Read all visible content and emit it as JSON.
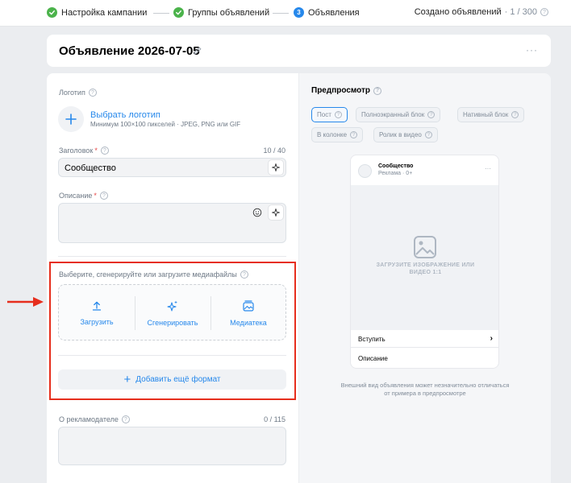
{
  "stepper": {
    "steps": [
      {
        "label": "Настройка кампании",
        "state": "done"
      },
      {
        "label": "Группы объявлений",
        "state": "done"
      },
      {
        "label": "Объявления",
        "state": "current",
        "number": "3"
      }
    ],
    "created_label": "Создано объявлений",
    "created_count": "· 1 / 300"
  },
  "header": {
    "title": "Объявление 2026-07-05",
    "more": "···"
  },
  "form": {
    "logo_label": "Логотип",
    "logo_link": "Выбрать логотип",
    "logo_hint": "Минимум 100×100 пикселей · JPEG, PNG или GIF",
    "title_label": "Заголовок",
    "title_required": "*",
    "title_count": "10 / 40",
    "title_value": "Сообщество",
    "desc_label": "Описание",
    "desc_required": "*",
    "media_label": "Выберите, сгенерируйте или загрузите медиафайлы",
    "media_options": [
      {
        "label": "Загрузить",
        "icon": "upload-icon"
      },
      {
        "label": "Сгенерировать",
        "icon": "sparkles-icon"
      },
      {
        "label": "Медиатека",
        "icon": "media-library-icon"
      }
    ],
    "add_format": "Добавить ещё формат",
    "advertiser_label": "О рекламодателе",
    "advertiser_count": "0 / 115"
  },
  "preview": {
    "title": "Предпросмотр",
    "chips": [
      {
        "label": "Пост",
        "active": true
      },
      {
        "label": "Полноэкранный блок",
        "active": false
      },
      {
        "label": "Нативный блок",
        "active": false
      },
      {
        "label": "В колонке",
        "active": false
      },
      {
        "label": "Ролик в видео",
        "active": false
      }
    ],
    "post_name": "Сообщество",
    "post_sub": "Реклама · 0+",
    "post_more": "···",
    "image_placeholder": "ЗАГРУЗИТЕ ИЗОБРАЖЕНИЕ ИЛИ ВИДЕО 1:1",
    "cta": "Вступить",
    "description": "Описание",
    "note": "Внешний вид объявления может незначительно отличаться от примера в предпросмотре"
  },
  "colors": {
    "accent": "#2688eb",
    "success": "#4bb34b",
    "highlight": "#e62e1d"
  }
}
